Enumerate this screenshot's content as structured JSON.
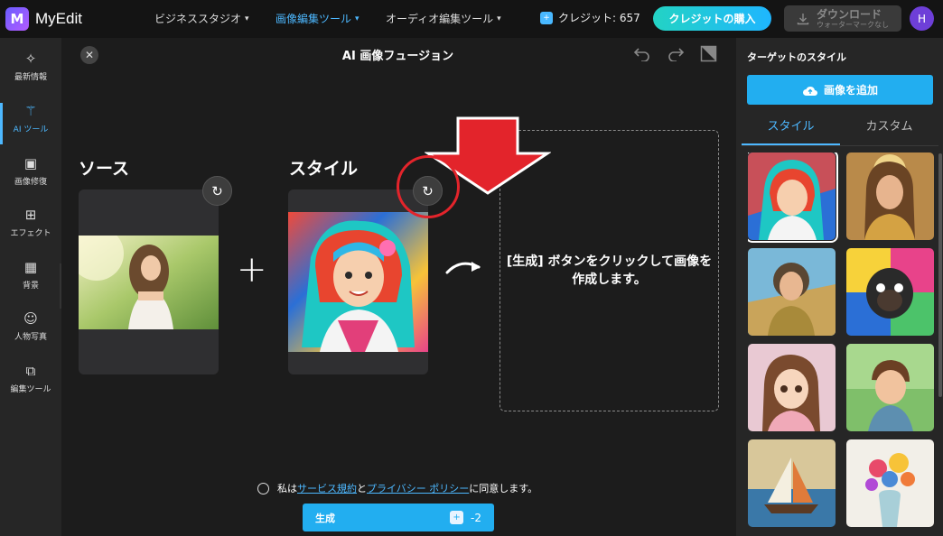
{
  "header": {
    "logo_letter": "M",
    "logo_text": "MyEdit",
    "nav": [
      {
        "label": "ビジネススタジオ",
        "active": false
      },
      {
        "label": "画像編集ツール",
        "active": true
      },
      {
        "label": "オーディオ編集ツール",
        "active": false
      }
    ],
    "credits_label": "クレジット: 657",
    "buy_label": "クレジットの購入",
    "download_label": "ダウンロード",
    "download_sub": "ウォーターマークなし",
    "avatar_letter": "H"
  },
  "sidebar": {
    "items": [
      {
        "label": "最新情報",
        "icon": "sparkle-icon"
      },
      {
        "label": "AI ツール",
        "icon": "magic-wand-icon",
        "active": true
      },
      {
        "label": "画像修復",
        "icon": "image-repair-icon"
      },
      {
        "label": "エフェクト",
        "icon": "effects-icon"
      },
      {
        "label": "背景",
        "icon": "background-icon"
      },
      {
        "label": "人物写真",
        "icon": "portrait-icon"
      },
      {
        "label": "編集ツール",
        "icon": "edit-tools-icon"
      }
    ]
  },
  "main": {
    "title": "AI 画像フュージョン",
    "source_label": "ソース",
    "style_label": "スタイル",
    "result_text": "[生成] ボタンをクリックして画像を作成します。",
    "agree": {
      "prefix": "私は",
      "terms": "サービス規約",
      "and": "と",
      "privacy": "プライバシー ポリシー",
      "suffix": "に同意します。"
    },
    "generate_label": "生成",
    "generate_cost": "-2"
  },
  "right_panel": {
    "title": "ターゲットのスタイル",
    "add_image_label": "画像を追加",
    "tabs": [
      {
        "label": "スタイル",
        "active": true
      },
      {
        "label": "カスタム",
        "active": false
      }
    ],
    "thumbnails": [
      {
        "name": "colorful-anime-girl",
        "selected": true
      },
      {
        "name": "golden-goddess"
      },
      {
        "name": "pilot-woman"
      },
      {
        "name": "pop-art-pug"
      },
      {
        "name": "cartoon-girl"
      },
      {
        "name": "cartoon-boy"
      },
      {
        "name": "sailboat-painting"
      },
      {
        "name": "flower-vase"
      }
    ]
  },
  "colors": {
    "accent": "#22aef0",
    "annotation": "#e3242b"
  }
}
